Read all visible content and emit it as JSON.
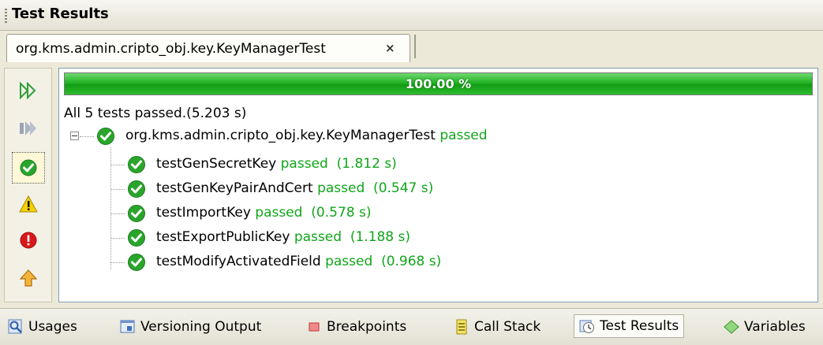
{
  "window": {
    "title": "Test Results"
  },
  "tab": {
    "label": "org.kms.admin.cripto_obj.key.KeyManagerTest",
    "close": "×"
  },
  "progress": {
    "text": "100.00 %",
    "value": 1.0,
    "color": "#1fae21"
  },
  "summary": "All 5 tests passed.(5.203 s)",
  "suite": {
    "name": "org.kms.admin.cripto_obj.key.KeyManagerTest",
    "status": "passed"
  },
  "tests": [
    {
      "name": "testGenSecretKey",
      "result": "passed  (1.812 s)"
    },
    {
      "name": "testGenKeyPairAndCert",
      "result": "passed  (0.547 s)"
    },
    {
      "name": "testImportKey",
      "result": "passed  (0.578 s)"
    },
    {
      "name": "testExportPublicKey",
      "result": "passed  (1.188 s)"
    },
    {
      "name": "testModifyActivatedField",
      "result": "passed  (0.968 s)"
    }
  ],
  "side_buttons": [
    {
      "icon": "rerun-icon"
    },
    {
      "icon": "rerun-failed-icon"
    },
    {
      "icon": "show-passed-icon"
    },
    {
      "icon": "warning-icon"
    },
    {
      "icon": "error-icon"
    },
    {
      "icon": "previous-failure-icon"
    }
  ],
  "bottom_tabs": [
    {
      "label": "Usages",
      "icon": "usages-icon"
    },
    {
      "label": "Versioning Output",
      "icon": "versioning-output-icon"
    },
    {
      "label": "Breakpoints",
      "icon": "breakpoints-icon"
    },
    {
      "label": "Call Stack",
      "icon": "call-stack-icon"
    },
    {
      "label": "Test Results",
      "icon": "test-results-icon",
      "active": true
    },
    {
      "label": "Variables",
      "icon": "variables-icon"
    }
  ],
  "colors": {
    "passed_text": "#11a51a",
    "check_green": "#2aa52c",
    "background": "#ece9d8"
  }
}
